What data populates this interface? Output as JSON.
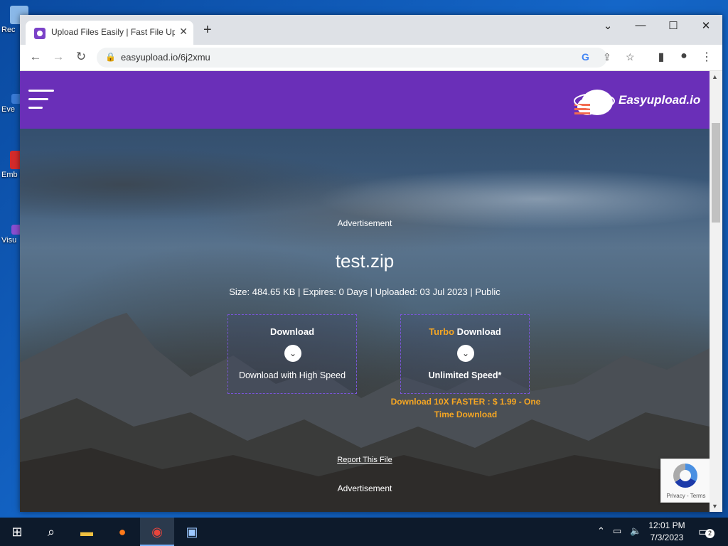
{
  "desktop": {
    "icons": [
      {
        "label": "Rec"
      },
      {
        "label": "Eve"
      },
      {
        "label": "Emb De"
      },
      {
        "label": "Visu"
      }
    ]
  },
  "browser": {
    "tab_title": "Upload Files Easily | Fast File Upl",
    "tab_close": "✕",
    "new_tab": "+",
    "url": "easyupload.io/6j2xmu",
    "window_controls": {
      "dropdown": "⌄",
      "minimize": "—",
      "maximize": "☐",
      "close": "✕"
    }
  },
  "site": {
    "logo_text": "Easyupload.io",
    "ad_top": "Advertisement",
    "file_name": "test.zip",
    "file_meta": "Size: 484.65 KB | Expires: 0 Days | Uploaded: 03 Jul 2023 | Public",
    "download": {
      "title": "Download",
      "sub": "Download with High Speed"
    },
    "turbo": {
      "prefix": "Turbo",
      "title": " Download",
      "sub": "Unlimited Speed*"
    },
    "promo": "Download 10X FASTER : $ 1.99 - One Time Download",
    "report": "Report This File",
    "ad_bottom": "Advertisement",
    "recaptcha": "Privacy - Terms"
  },
  "taskbar": {
    "time": "12:01 PM",
    "date": "7/3/2023",
    "notifications": "2"
  },
  "colors": {
    "header": "#6a2fb8",
    "accent": "#f5a623"
  }
}
